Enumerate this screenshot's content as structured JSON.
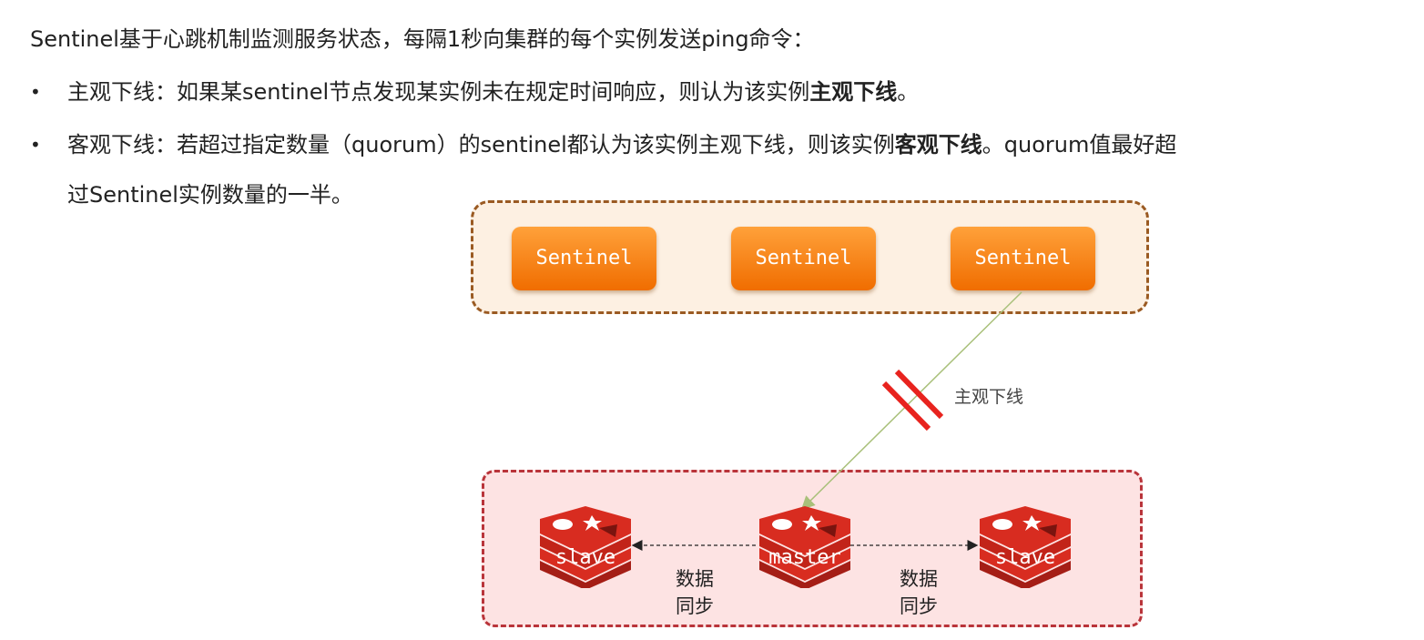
{
  "text": {
    "intro": "Sentinel基于心跳机制监测服务状态，每隔1秒向集群的每个实例发送ping命令：",
    "bullet_symbol": "•",
    "bullet1_prefix": "主观下线：如果某sentinel节点发现某实例未在规定时间响应，则认为该实例",
    "bullet1_bold": "主观下线",
    "bullet1_suffix": "。",
    "bullet2_prefix": "客观下线：若超过指定数量（quorum）的sentinel都认为该实例主观下线，则该实例",
    "bullet2_bold": "客观下线",
    "bullet2_suffix": "。quorum值最好超",
    "bullet2_line2": "过Sentinel实例数量的一半。"
  },
  "diagram": {
    "sentinels": [
      "Sentinel",
      "Sentinel",
      "Sentinel"
    ],
    "offline_label": "主观下线",
    "redis_nodes": [
      "slave",
      "master",
      "slave"
    ],
    "sync_label_left": [
      "数据",
      "同步"
    ],
    "sync_label_right": [
      "数据",
      "同步"
    ],
    "colors": {
      "sentinel_fill": "#f98a1a",
      "sentinel_group_border": "#9a5a22",
      "sentinel_group_bg": "#fdf0e2",
      "redis_group_border": "#b9343a",
      "redis_group_bg": "#fde3e3",
      "redis_red": "#d82c20",
      "cut_mark": "#e8231e",
      "link_line": "#a9c07a"
    }
  }
}
